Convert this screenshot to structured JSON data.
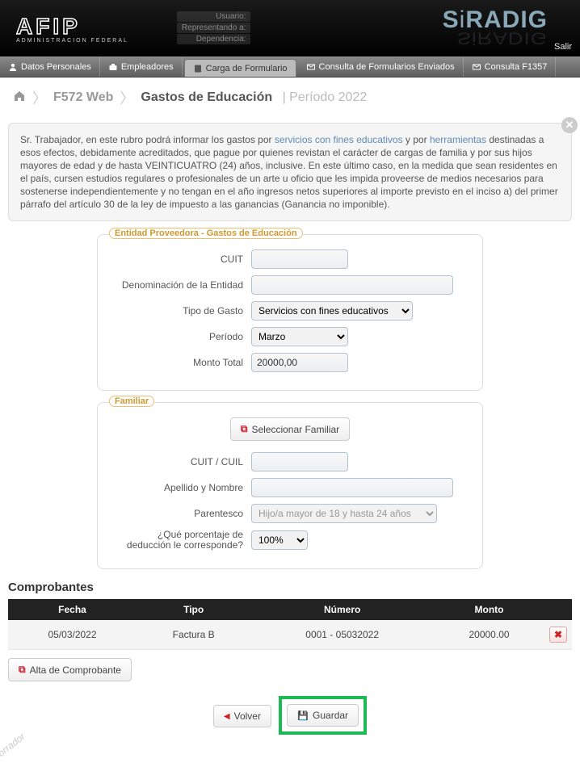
{
  "header": {
    "logo_sub": "ADMINISTRACION FEDERAL",
    "user_labels": {
      "usuario": "Usuario:",
      "representando": "Representando a:",
      "dependencia": "Dependencia:"
    },
    "siradig": "SiRADIG",
    "salir": "Salir"
  },
  "nav": {
    "items": [
      {
        "label": "Datos Personales"
      },
      {
        "label": "Empleadores"
      },
      {
        "label": "Carga de Formulario"
      },
      {
        "label": "Consulta de Formularios Enviados"
      },
      {
        "label": "Consulta F1357"
      }
    ]
  },
  "breadcrumb": {
    "step1": "F572 Web",
    "step2": "Gastos de Educación",
    "period": "Período 2022"
  },
  "info": {
    "pre": "Sr. Trabajador, en este rubro podrá informar los gastos por ",
    "link1": "servicios con fines educativos",
    "mid": " y por ",
    "link2": "herramientas",
    "post": " destinadas a esos efectos, debidamente acreditados, que pague por quienes revistan el carácter de cargas de familia y por sus hijos mayores de edad y de hasta VEINTICUATRO (24) años, inclusive. En este último caso, en la medida que sean residentes en el país, cursen estudios regulares o profesionales de un arte u oficio que les impida proveerse de medios necesarios para sostenerse independientemente y no tengan en el año ingresos netos superiores al importe previsto en el inciso a) del primer párrafo del artículo 30 de la ley de impuesto a las ganancias (Ganancia no imponible)."
  },
  "fieldset1": {
    "legend": "Entidad Proveedora - Gastos de Educación",
    "cuit_label": "CUIT",
    "cuit_value": "",
    "denom_label": "Denominación de la Entidad",
    "denom_value": "",
    "tipo_label": "Tipo de Gasto",
    "tipo_value": "Servicios con fines educativos",
    "periodo_label": "Período",
    "periodo_value": "Marzo",
    "monto_label": "Monto Total",
    "monto_value": "20000,00"
  },
  "fieldset2": {
    "legend": "Familiar",
    "select_btn": "Seleccionar Familiar",
    "cuit_label": "CUIT / CUIL",
    "cuit_value": "",
    "nombre_label": "Apellido y Nombre",
    "nombre_value": "",
    "parentesco_label": "Parentesco",
    "parentesco_value": "Hijo/a mayor de 18 y hasta 24 años",
    "porcentaje_label": "¿Qué porcentaje de deducción le corresponde?",
    "porcentaje_value": "100%"
  },
  "comprobantes": {
    "title": "Comprobantes",
    "headers": {
      "fecha": "Fecha",
      "tipo": "Tipo",
      "numero": "Número",
      "monto": "Monto"
    },
    "rows": [
      {
        "fecha": "05/03/2022",
        "tipo": "Factura B",
        "numero": "0001 - 05032022",
        "monto": "20000.00"
      }
    ],
    "alta_btn": "Alta de Comprobante"
  },
  "actions": {
    "volver": "Volver",
    "guardar": "Guardar"
  },
  "borrador": "borrador"
}
